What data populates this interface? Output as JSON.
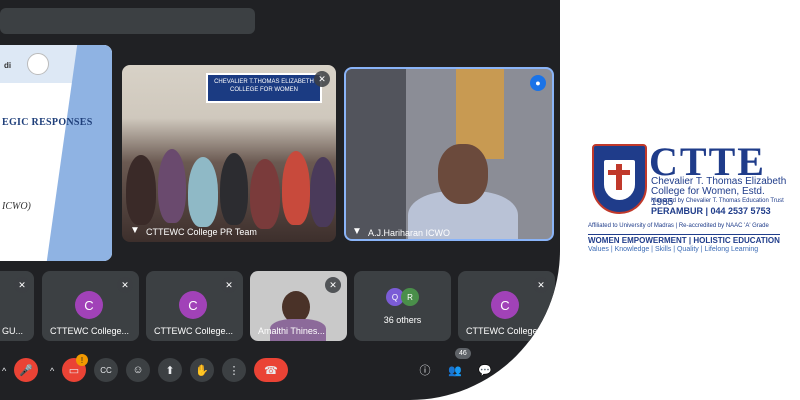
{
  "slide": {
    "logo_text": "di",
    "title_fragment": "EGIC RESPONSES",
    "subtitle_fragment": "ICWO)"
  },
  "tiles": {
    "crowd": {
      "banner": "CHEVALIER T.THOMAS ELIZABETH COLLEGE FOR WOMEN",
      "name": "CTTEWC College PR Team"
    },
    "speaker": {
      "name": "A.J.Hariharan ICWO"
    },
    "bottom": [
      {
        "name": "GU...",
        "type": "partial"
      },
      {
        "name": "CTTEWC College...",
        "initial": "C"
      },
      {
        "name": "CTTEWC College...",
        "initial": "C"
      },
      {
        "name": "Amalthi Thines..."
      },
      {
        "name": "36 others",
        "initials": [
          "Q",
          "R"
        ]
      },
      {
        "name": "CTTEWC College...",
        "initial": "C"
      }
    ]
  },
  "controls": {
    "hand_badge": "!",
    "participant_count": "46",
    "captions_label": "CC"
  },
  "brand": {
    "acronym": "CTTE",
    "line1": "Chevalier T. Thomas Elizabeth",
    "line2": "College for Women, Estd. 1985",
    "line3": "Managed by Chevalier T. Thomas Education Trust",
    "line4": "PERAMBUR | 044 2537 5753",
    "affiliation": "Affiliated to University of Madras | Re-accredited by NAAC 'A' Grade",
    "tagline": "WOMEN EMPOWERMENT | HOLISTIC EDUCATION",
    "values": "Values | Knowledge | Skills | Quality | Lifelong Learning"
  },
  "colors": {
    "meet_bg": "#202124",
    "tile_bg": "#3c4043",
    "active_border": "#8ab4f8",
    "end_call": "#ea4335",
    "brand_blue": "#1f3c8a",
    "avatar_purple": "#a142b8"
  }
}
